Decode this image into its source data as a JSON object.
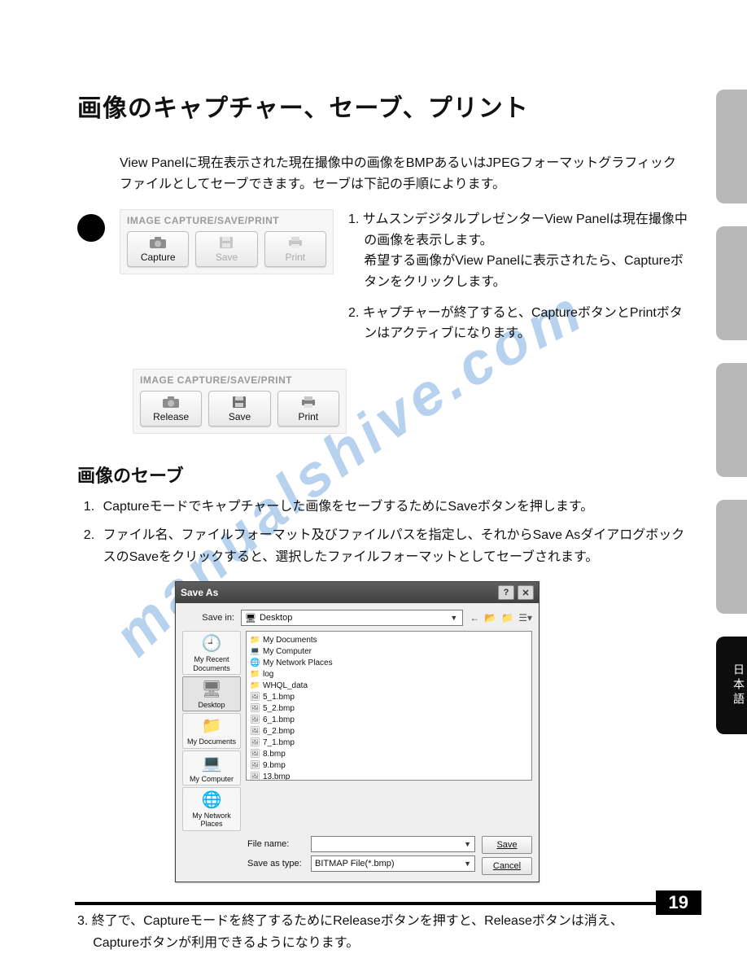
{
  "title": "画像のキャプチャー、セーブ、プリント",
  "intro": "View Panelに現在表示された現在撮像中の画像をBMPあるいはJPEGフォーマットグラフィックファイルとしてセーブできます。セーブは下記の手順によります。",
  "toolbar": {
    "header": "IMAGE CAPTURE/SAVE/PRINT",
    "state1": {
      "b1": "Capture",
      "b2": "Save",
      "b3": "Print"
    },
    "state2": {
      "b1": "Release",
      "b2": "Save",
      "b3": "Print"
    }
  },
  "top_steps": {
    "s1a": "1. サムスンデジタルプレゼンターView Panelは現在撮像中の画像を表示します。",
    "s1b": "希望する画像がView Panelに表示されたら、Captureボタンをクリックします。",
    "s2": "2. キャプチャーが終了すると、CaptureボタンとPrintボタンはアクティブになります。"
  },
  "save_section": {
    "heading": "画像のセーブ",
    "li1": "Captureモードでキャプチャーした画像をセーブするためにSaveボタンを押します。",
    "li2": "ファイル名、ファイルフォーマット及びファイルパスを指定し、それからSave AsダイアログボックスのSaveをクリックすると、選択したファイルフォーマットとしてセーブされます。"
  },
  "saveas": {
    "title": "Save As",
    "help": "?",
    "close": "✕",
    "savein_label": "Save in:",
    "savein_value": "Desktop",
    "places": [
      {
        "label": "My Recent Documents",
        "icon": "🕘"
      },
      {
        "label": "Desktop",
        "icon": "🖥",
        "active": true
      },
      {
        "label": "My Documents",
        "icon": "📁"
      },
      {
        "label": "My Computer",
        "icon": "💻"
      },
      {
        "label": "My Network Places",
        "icon": "🌐"
      }
    ],
    "files": [
      {
        "icon": "📁",
        "name": "My Documents"
      },
      {
        "icon": "💻",
        "name": "My Computer"
      },
      {
        "icon": "🌐",
        "name": "My Network Places"
      },
      {
        "icon": "📁",
        "name": "log"
      },
      {
        "icon": "📁",
        "name": "WHQL_data"
      },
      {
        "icon": "🖼",
        "name": "5_1.bmp"
      },
      {
        "icon": "🖼",
        "name": "5_2.bmp"
      },
      {
        "icon": "🖼",
        "name": "6_1.bmp"
      },
      {
        "icon": "🖼",
        "name": "6_2.bmp"
      },
      {
        "icon": "🖼",
        "name": "7_1.bmp"
      },
      {
        "icon": "🖼",
        "name": "8.bmp"
      },
      {
        "icon": "🖼",
        "name": "9.bmp"
      },
      {
        "icon": "🖼",
        "name": "13.bmp"
      }
    ],
    "filename_label": "File name:",
    "filename_value": "",
    "savetype_label": "Save as type:",
    "savetype_value": "BITMAP File(*.bmp)",
    "btn_save": "Save",
    "btn_cancel": "Cancel"
  },
  "final_note": {
    "l1": "3. 終了で、Captureモードを終了するためにReleaseボタンを押すと、Releaseボタンは消え、",
    "l2": "Captureボタンが利用できるようになります。"
  },
  "tab_black": "日本語",
  "page_number": "19"
}
